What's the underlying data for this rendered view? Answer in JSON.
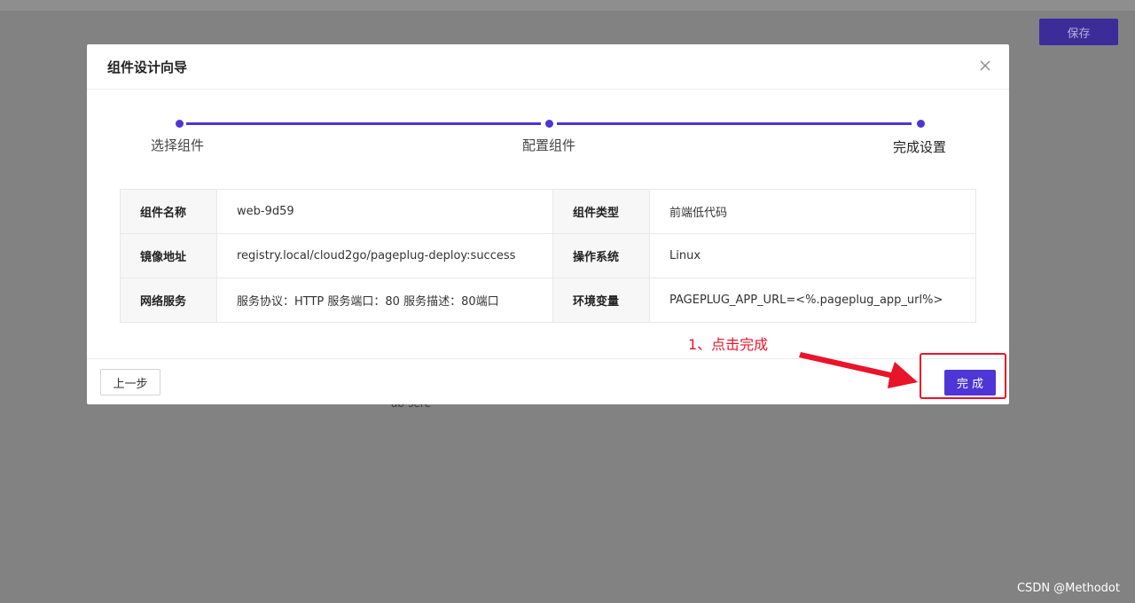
{
  "background": {
    "save_label": "保存",
    "partial_text": "ab-sere",
    "watermark": "CSDN @Methodot"
  },
  "modal": {
    "title": "组件设计向导",
    "steps": [
      {
        "label": "选择组件"
      },
      {
        "label": "配置组件"
      },
      {
        "label": "完成设置"
      }
    ],
    "table": {
      "rows": [
        {
          "label1": "组件名称",
          "value1": "web-9d59",
          "label2": "组件类型",
          "value2": "前端低代码"
        },
        {
          "label1": "镜像地址",
          "value1": "registry.local/cloud2go/pageplug-deploy:success",
          "label2": "操作系统",
          "value2": "Linux"
        },
        {
          "label1": "网络服务",
          "value1": "服务协议：HTTP 服务端口：80 服务描述：80端口",
          "label2": "环境变量",
          "value2": "PAGEPLUG_APP_URL=<%.pageplug_app_url%>"
        }
      ]
    },
    "footer": {
      "prev_label": "上一步",
      "finish_label": "完 成"
    }
  },
  "annotation": {
    "text": "1、点击完成"
  },
  "colors": {
    "accent": "#4d35d6",
    "annotation_red": "#e8142a",
    "overlay": "#828282"
  }
}
